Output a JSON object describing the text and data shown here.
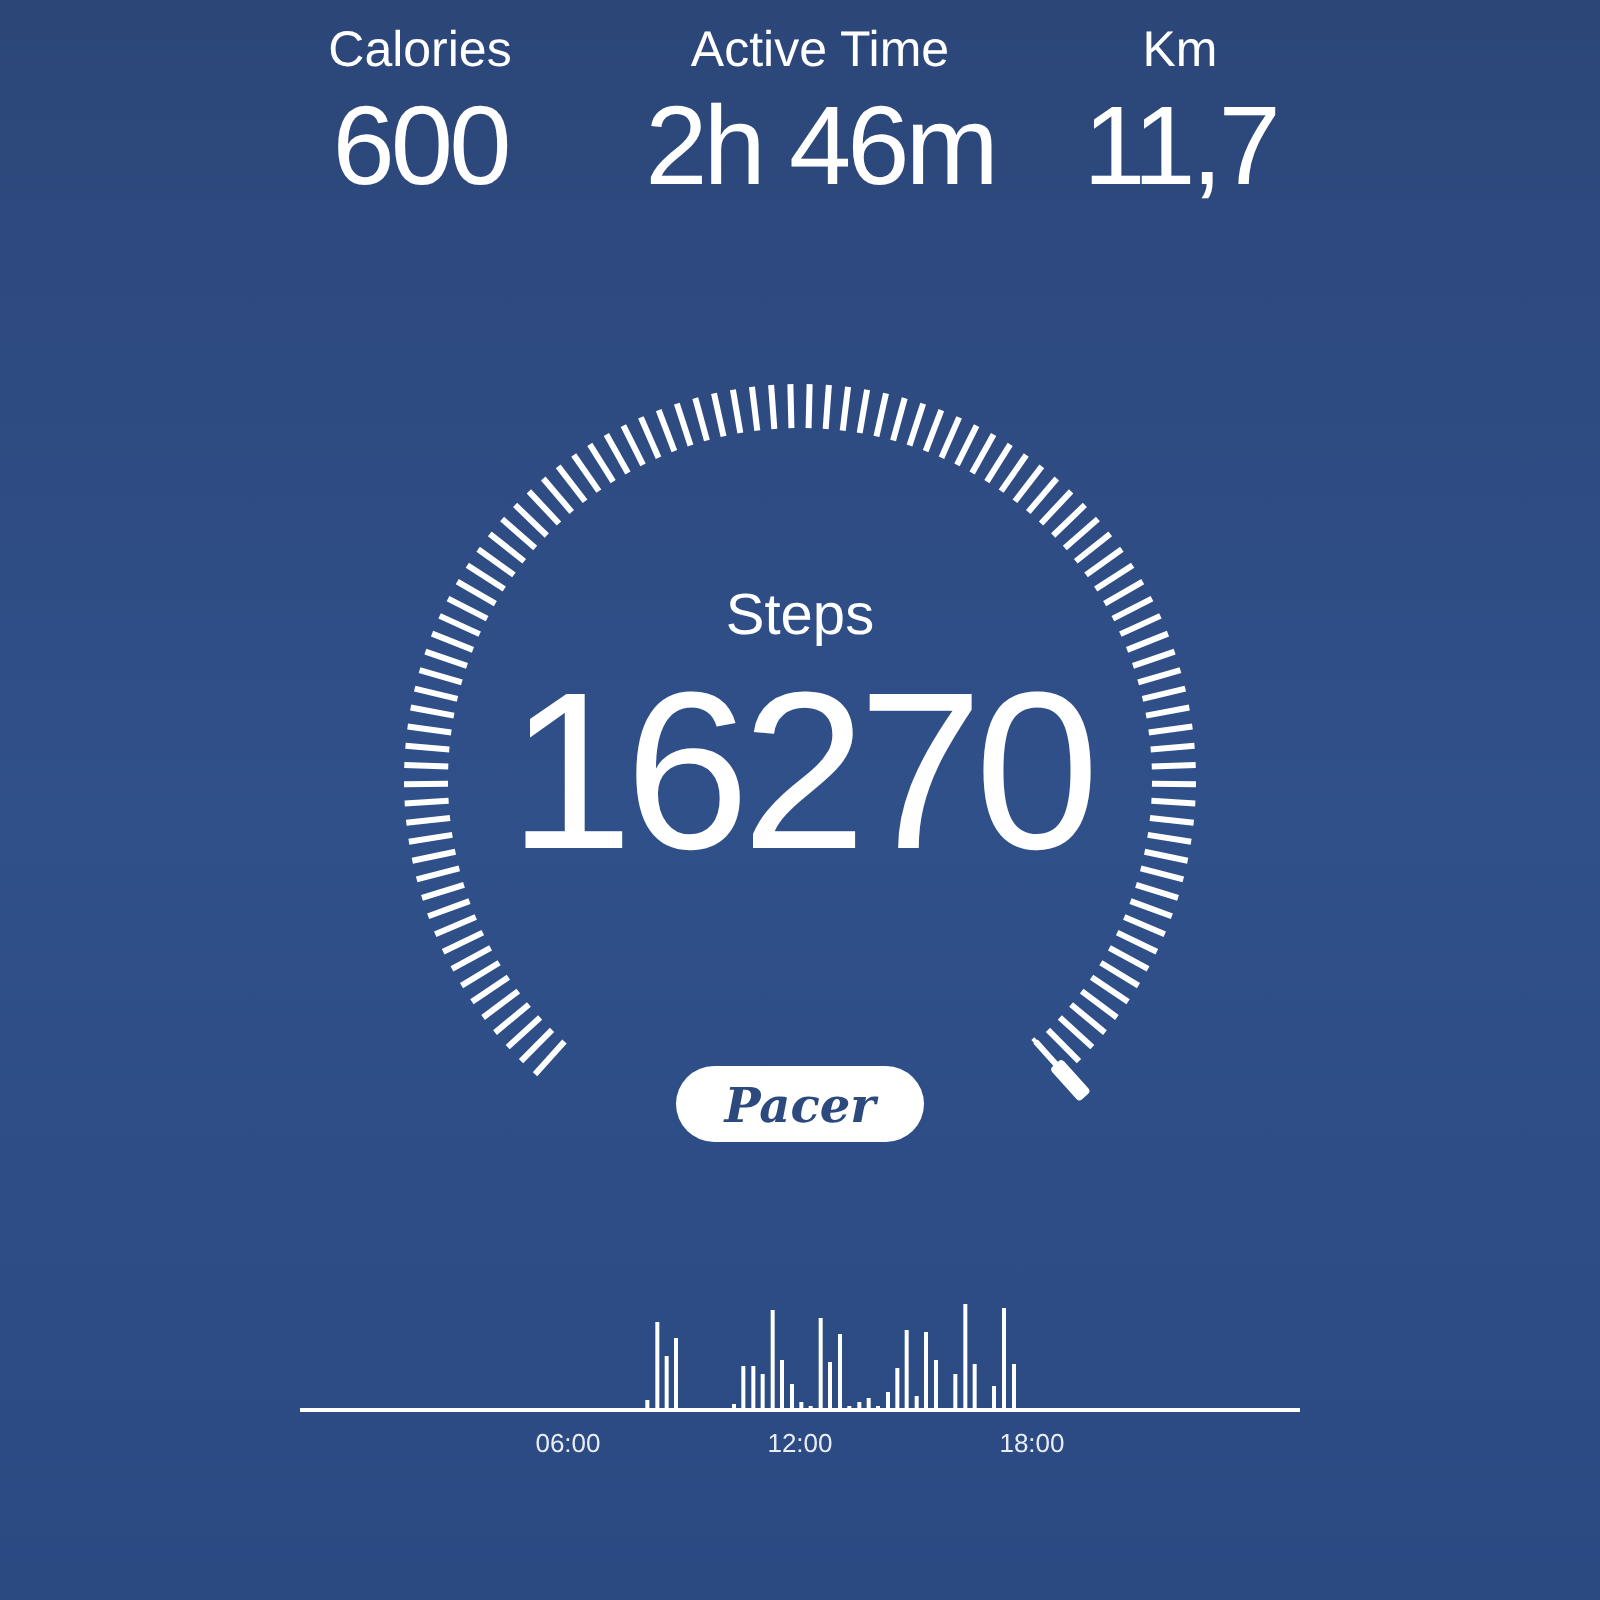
{
  "stats": [
    {
      "label": "Calories",
      "value": "600"
    },
    {
      "label": "Active Time",
      "value": "2h 46m"
    },
    {
      "label": "Km",
      "value": "11,7"
    }
  ],
  "steps": {
    "label": "Steps",
    "value": "16270"
  },
  "logo": {
    "text": "Pacer"
  },
  "activity_chart": {
    "time_labels": [
      "06:00",
      "12:00",
      "18:00"
    ]
  }
}
